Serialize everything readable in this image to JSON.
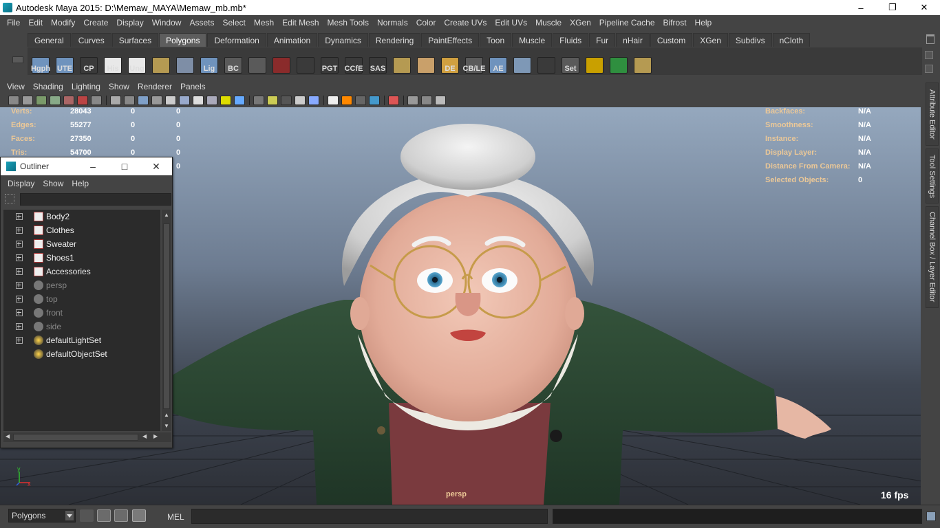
{
  "window": {
    "title": "Autodesk Maya 2015: D:\\Memaw_MAYA\\Memaw_mb.mb*",
    "minimize": "–",
    "restore": "❐",
    "close": "✕"
  },
  "menubar": [
    "File",
    "Edit",
    "Modify",
    "Create",
    "Display",
    "Window",
    "Assets",
    "Select",
    "Mesh",
    "Edit Mesh",
    "Mesh Tools",
    "Normals",
    "Color",
    "Create UVs",
    "Edit UVs",
    "Muscle",
    "XGen",
    "Pipeline Cache",
    "Bifrost",
    "Help"
  ],
  "shelf": {
    "tabs": [
      "General",
      "Curves",
      "Surfaces",
      "Polygons",
      "Deformation",
      "Animation",
      "Dynamics",
      "Rendering",
      "PaintEffects",
      "Toon",
      "Muscle",
      "Fluids",
      "Fur",
      "nHair",
      "Custom",
      "XGen",
      "Subdivs",
      "nCloth"
    ],
    "active_tab": "Polygons",
    "icons": [
      {
        "name": "hgph-icon",
        "label": "Hgph",
        "color": "#6f93bd"
      },
      {
        "name": "ute-icon",
        "label": "UTE",
        "color": "#6f93bd"
      },
      {
        "name": "cp-icon",
        "label": "CP",
        "color": "#3a3a3a"
      },
      {
        "name": "his-icon",
        "label": "His",
        "color": "#e8e8e8"
      },
      {
        "name": "ung-icon",
        "label": "Ung",
        "color": "#e8e8e8"
      },
      {
        "name": "plane-tool-icon",
        "label": "",
        "color": "#b59a52"
      },
      {
        "name": "lasso-sphere-icon",
        "label": "",
        "color": "#7e8ea6"
      },
      {
        "name": "lig-icon",
        "label": "Lig",
        "color": "#6f93bd"
      },
      {
        "name": "bc-icon",
        "label": "BC",
        "color": "#5a5a5a"
      },
      {
        "name": "mesh-box-icon",
        "label": "",
        "color": "#5a5a5a"
      },
      {
        "name": "camera-red-icon",
        "label": "",
        "color": "#8a2b2b"
      },
      {
        "name": "curve-tool-icon",
        "label": "",
        "color": "#3a3a3a"
      },
      {
        "name": "pgt-icon",
        "label": "PGT",
        "color": "#3a3a3a"
      },
      {
        "name": "ccfe-icon",
        "label": "CCfE",
        "color": "#3a3a3a"
      },
      {
        "name": "sas-icon",
        "label": "SAS",
        "color": "#3a3a3a"
      },
      {
        "name": "uv-plane-icon",
        "label": "",
        "color": "#b59a52"
      },
      {
        "name": "uv-grid-icon",
        "label": "",
        "color": "#c9a06a"
      },
      {
        "name": "de-icon",
        "label": "DE",
        "color": "#d0a040"
      },
      {
        "name": "cb-le-icon",
        "label": "CB/LE",
        "color": "#5a5a5a"
      },
      {
        "name": "ae-icon",
        "label": "AE",
        "color": "#6f93bd"
      },
      {
        "name": "blob-icon",
        "label": "",
        "color": "#7e98b6"
      },
      {
        "name": "spiral-curve-icon",
        "label": "",
        "color": "#3a3a3a"
      },
      {
        "name": "set-key-icon",
        "label": "Set",
        "color": "#5a5a5a"
      },
      {
        "name": "target-yellow-icon",
        "label": "",
        "color": "#c9a000"
      },
      {
        "name": "target-color-icon",
        "label": "",
        "color": "#2f8f3f"
      },
      {
        "name": "plane-stack-icon",
        "label": "",
        "color": "#b59a52"
      }
    ]
  },
  "panel": {
    "menu": [
      "View",
      "Shading",
      "Lighting",
      "Show",
      "Renderer",
      "Panels"
    ]
  },
  "hud": {
    "left_rows": [
      {
        "label": "Verts:",
        "v1": "28043",
        "v2": "0",
        "v3": "0"
      },
      {
        "label": "Edges:",
        "v1": "55277",
        "v2": "0",
        "v3": "0"
      },
      {
        "label": "Faces:",
        "v1": "27350",
        "v2": "0",
        "v3": "0"
      },
      {
        "label": "Tris:",
        "v1": "54700",
        "v2": "0",
        "v3": "0"
      },
      {
        "label": "",
        "v1": "",
        "v2": "",
        "v3": "0"
      }
    ],
    "right_rows": [
      {
        "label": "Backfaces:",
        "value": "N/A"
      },
      {
        "label": "Smoothness:",
        "value": "N/A"
      },
      {
        "label": "Instance:",
        "value": "N/A"
      },
      {
        "label": "Display Layer:",
        "value": "N/A"
      },
      {
        "label": "Distance From Camera:",
        "value": "N/A"
      },
      {
        "label": "Selected Objects:",
        "value": "0"
      }
    ],
    "camera": "persp",
    "fps": "16 fps",
    "axis_x": "x",
    "axis_y": "y"
  },
  "side_tabs": [
    "Attribute Editor",
    "Tool Settings",
    "Channel Box / Layer Editor"
  ],
  "outliner": {
    "title": "Outliner",
    "menu": [
      "Display",
      "Show",
      "Help"
    ],
    "search_value": "",
    "items": [
      {
        "name": "Body2",
        "type": "mesh",
        "dim": false,
        "expand": true
      },
      {
        "name": "Clothes",
        "type": "mesh",
        "dim": false,
        "expand": true
      },
      {
        "name": "Sweater",
        "type": "mesh",
        "dim": false,
        "expand": true
      },
      {
        "name": "Shoes1",
        "type": "mesh",
        "dim": false,
        "expand": true
      },
      {
        "name": "Accessories",
        "type": "mesh",
        "dim": false,
        "expand": true
      },
      {
        "name": "persp",
        "type": "camera",
        "dim": true,
        "expand": true
      },
      {
        "name": "top",
        "type": "camera",
        "dim": true,
        "expand": true
      },
      {
        "name": "front",
        "type": "camera",
        "dim": true,
        "expand": true
      },
      {
        "name": "side",
        "type": "camera",
        "dim": true,
        "expand": true
      },
      {
        "name": "defaultLightSet",
        "type": "set",
        "dim": false,
        "expand": true
      },
      {
        "name": "defaultObjectSet",
        "type": "set",
        "dim": false,
        "expand": false
      }
    ]
  },
  "bottom": {
    "mode": "Polygons",
    "mel_label": "MEL",
    "command_value": ""
  },
  "colors": {
    "hud_label": "#ecc897",
    "active_tab": "#5d5d5d",
    "sweater": "#2e4a34",
    "skin": "#e9b8a6",
    "hair": "#e4e4e4"
  }
}
